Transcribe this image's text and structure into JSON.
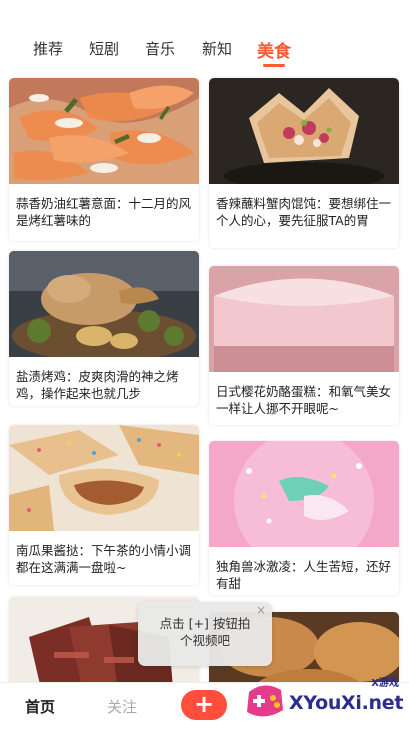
{
  "tabs": [
    {
      "label": "推荐"
    },
    {
      "label": "短剧"
    },
    {
      "label": "音乐"
    },
    {
      "label": "新知"
    },
    {
      "label": "美食"
    }
  ],
  "active_tab": "美食",
  "cards": [
    {
      "title": "蒜香奶油红薯意面：十二月的风是烤红薯味的"
    },
    {
      "title": "香辣蘸料蟹肉馄饨：要想绑住一个人的心，要先征服TA的胃"
    },
    {
      "title": "盐渍烤鸡：皮爽肉滑的神之烤鸡，操作起来也就几步"
    },
    {
      "title": "日式樱花奶酪蛋糕：和氧气美女一样让人挪不开眼呢~"
    },
    {
      "title": "南瓜果酱挞：下午茶的小情小调都在这满满一盘啦~"
    },
    {
      "title": "独角兽冰激凌：人生苦短，还好有甜"
    }
  ],
  "tooltip": {
    "text": "点击 [+] 按钮拍\n个视频吧",
    "close": "×"
  },
  "bottom_nav": {
    "home": "首页",
    "follow": "关注",
    "plus": "+"
  },
  "watermark": {
    "text": "XYouXi.net",
    "small": "X游戏"
  },
  "colors": {
    "accent": "#ff5a35",
    "plus": "#ff4f3c"
  }
}
